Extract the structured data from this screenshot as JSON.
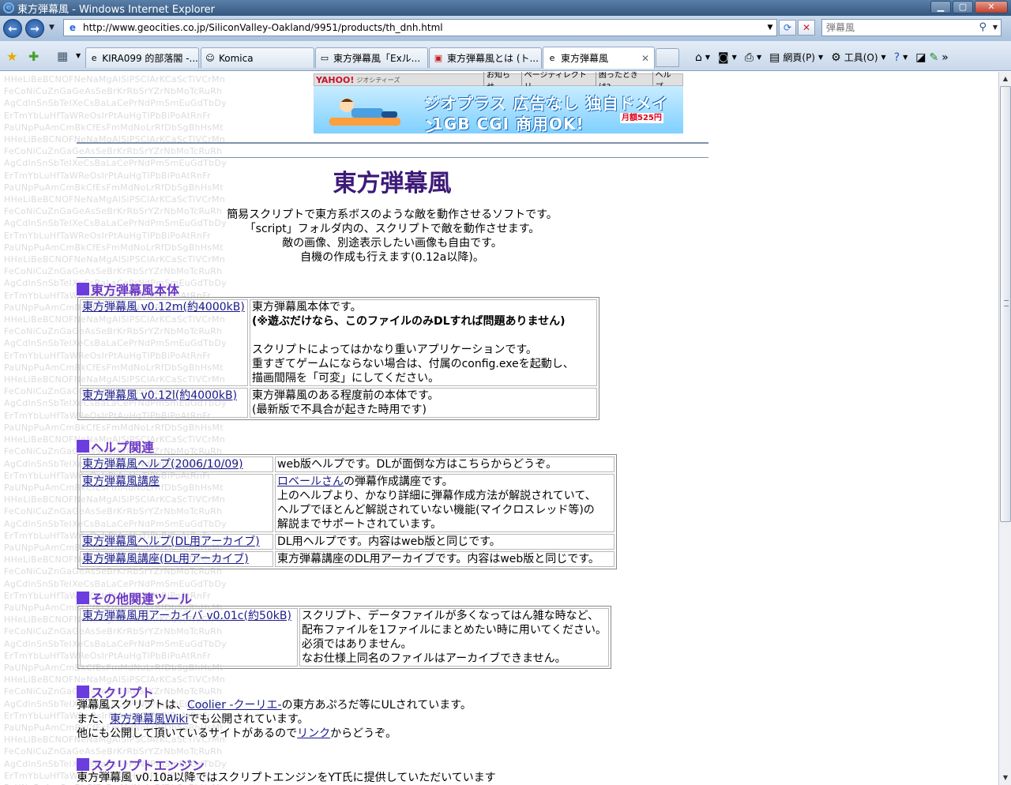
{
  "window": {
    "title": "東方弾幕風 - Windows Internet Explorer",
    "min_glyph": "▁",
    "max_glyph": "▢",
    "close_glyph": "✕"
  },
  "addressbar": {
    "url": "http://www.geocities.co.jp/SiliconValley-Oakland/9951/products/th_dnh.html",
    "search_placeholder": "弾幕風"
  },
  "tabs": [
    {
      "label": "KIRA099 的部落閣 -..."
    },
    {
      "label": "Komica"
    },
    {
      "label": "東方弾幕風「Exル..."
    },
    {
      "label": "東方弾幕風とは (ト..."
    },
    {
      "label": "東方弾幕風"
    }
  ],
  "toolbar": {
    "page_label": "網頁(P)",
    "tools_label": "工具(O)"
  },
  "background_text": "HHeLiBeBCNOFNeNaMgAlSiPSClArKCaScTiVCrMn\nFeCoNiCuZnGaGeAsSeBrKrRbSrYZrNbMoTcRuRh\nAgCdInSnSbTeIXeCsBaLaCePrNdPmSmEuGdTbDy\nErTmYbLuHfTaWReOsIrPtAuHgTlPbBiPoAtRnFr\nPaUNpPuAmCmBkCfEsFmMdNoLrRfDbSgBhHsMt",
  "banner": {
    "yahoo_logo": "YAHOO!",
    "yahoo_sub": "ジオシティーズ",
    "links": [
      "お知らせ",
      "ページディレクトリ",
      "困ったときは?",
      "ヘルプ"
    ],
    "line1": "ジオプラス 広告なし 独自ドメイン",
    "line2": "1GB CGI 商用OK!",
    "price": "月額525円"
  },
  "page": {
    "title": "東方弾幕風",
    "intro": [
      "簡易スクリプトで東方系ボスのような敵を動作させるソフトです。",
      "「script」フォルダ内の、スクリプトで敵を動作させます。",
      "敵の画像、別途表示したい画像も自由です。",
      "自機の作成も行えます(0.12a以降)。"
    ]
  },
  "sections": {
    "main": {
      "heading": "東方弾幕風本体",
      "rows": [
        {
          "link": "東方弾幕風 v0.12m(約4000kB)",
          "desc1": "東方弾幕風本体です。",
          "desc_bold": "(※遊ぶだけなら、このファイルのみDLすれば問題ありません)",
          "desc2": "スクリプトによってはかなり重いアプリケーションです。",
          "desc3": "重すぎてゲームにならない場合は、付属のconfig.exeを起動し、",
          "desc4": "描画間隔を「可変」にしてください。"
        },
        {
          "link": "東方弾幕風 v0.12l(約4000kB)",
          "desc1": "東方弾幕風のある程度前の本体です。",
          "desc2": "(最新版で不具合が起きた時用です)"
        }
      ]
    },
    "help": {
      "heading": "ヘルプ関連",
      "rows": [
        {
          "link": "東方弾幕風ヘルプ(2006/10/09)",
          "desc1": "web版ヘルプです。DLが面倒な方はこちらからどうぞ。"
        },
        {
          "link": "東方弾幕風講座",
          "desc_link": "ロベールさん",
          "desc1": "の弾幕作成講座です。",
          "desc2": "上のヘルプより、かなり詳細に弾幕作成方法が解説されていて、",
          "desc3": "ヘルプでほとんど解説されていない機能(マイクロスレッド等)の",
          "desc4": "解説までサポートされています。"
        },
        {
          "link": "東方弾幕風ヘルプ(DL用アーカイブ)",
          "desc1": "DL用ヘルプです。内容はweb版と同じです。"
        },
        {
          "link": "東方弾幕風講座(DL用アーカイブ)",
          "desc1": "東方弾幕講座のDL用アーカイブです。内容はweb版と同じです。"
        }
      ]
    },
    "tools": {
      "heading": "その他関連ツール",
      "rows": [
        {
          "link": "東方弾幕風用アーカイバ v0.01c(約50kB)",
          "desc1": "スクリプト、データファイルが多くなってはん雑な時など、",
          "desc2": "配布ファイルを1ファイルにまとめたい時に用いてください。",
          "desc3": "必須ではありません。",
          "desc4": "なお仕様上同名のファイルはアーカイブできません。"
        }
      ]
    },
    "script": {
      "heading": "スクリプト",
      "line1_pre": "弾幕風スクリプトは、",
      "line1_link": "Coolier -クーリエ-",
      "line1_post": "の東方あぷろだ等にULされています。",
      "line2_pre": "また、",
      "line2_link": "東方弾幕風Wiki",
      "line2_post": "でも公開されています。",
      "line3_pre": "他にも公開して頂いているサイトがあるので",
      "line3_link": "リンク",
      "line3_post": "からどうぞ。"
    },
    "engine": {
      "heading": "スクリプトエンジン",
      "line1_pre": "東方弾幕風 v0.10a以降ではスクリプトエンジンを",
      "line1_link": "YT氏",
      "line1_post": "に提供していただいています"
    }
  }
}
